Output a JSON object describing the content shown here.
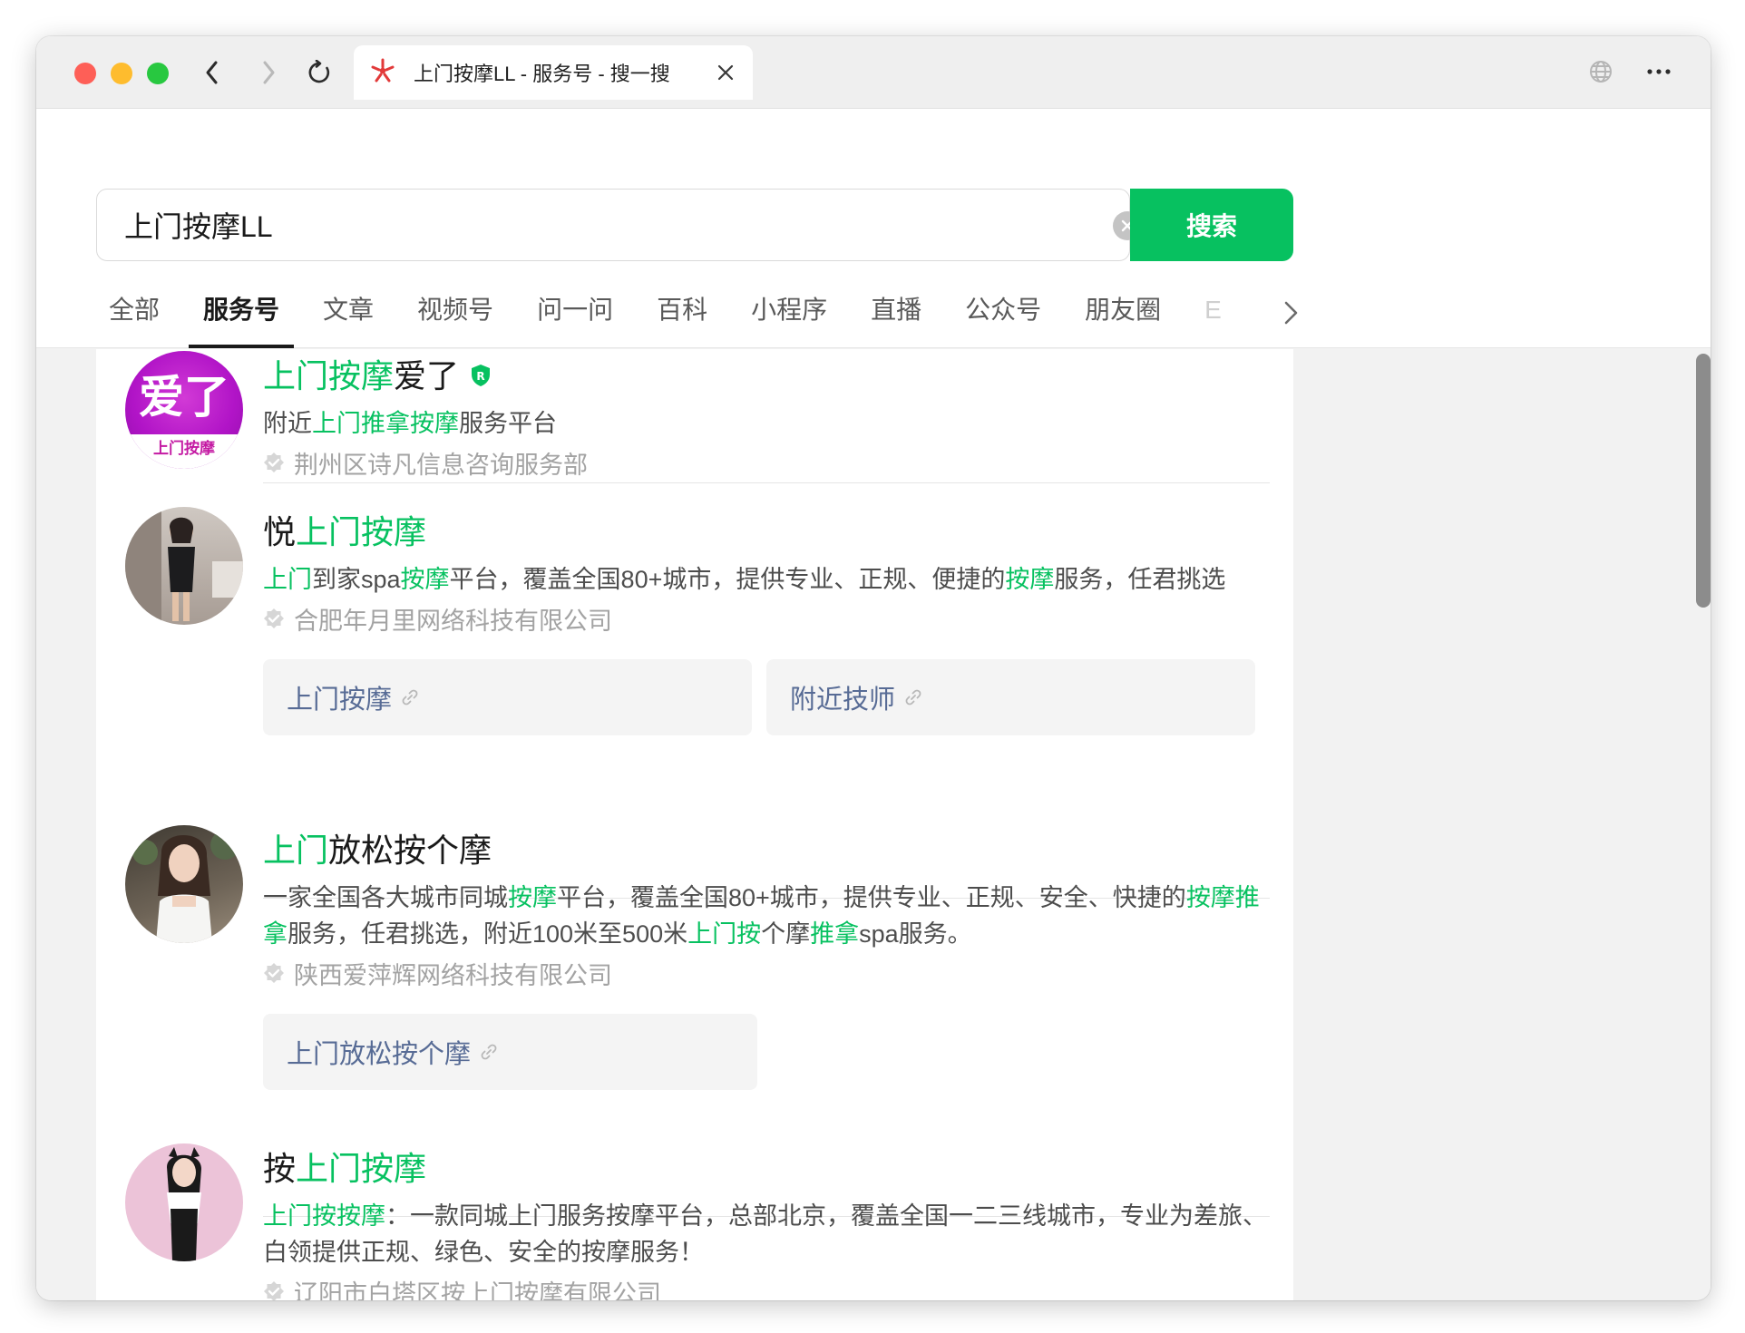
{
  "browser": {
    "tab_title": "上门按摩LL - 服务号 - 搜一搜"
  },
  "search": {
    "query": "上门按摩LL",
    "button_label": "搜索"
  },
  "tabs": [
    "全部",
    "服务号",
    "文章",
    "视频号",
    "问一问",
    "百科",
    "小程序",
    "直播",
    "公众号",
    "朋友圈",
    "E"
  ],
  "active_tab": "服务号",
  "results": [
    {
      "avatar_text": "爱了",
      "avatar_caption": "上门按摩",
      "title_hl": "上门按摩",
      "title_rest": "爱了",
      "badge": "R",
      "desc_pre": "附近",
      "desc_hl": "上门推拿按摩",
      "desc_post": "服务平台",
      "company": "荆州区诗凡信息咨询服务部"
    },
    {
      "title_pre": "悦",
      "title_hl": "上门按摩",
      "desc_parts": [
        "上门",
        "到家spa",
        "按摩",
        "平台，覆盖全国80+城市，提供专业、正规、便捷的",
        "按摩",
        "服务，任君挑选"
      ],
      "company": "合肥年月里网络科技有限公司",
      "links": [
        "上门按摩",
        "附近技师"
      ]
    },
    {
      "title_hl": "上门",
      "title_rest": "放松按个摩",
      "desc_parts": [
        "一家全国各大城市同城",
        "按摩",
        "平台，覆盖全国80+城市，提供专业、正规、安全、快捷的",
        "按摩推拿",
        "服务，任君挑选，附近100米至500米",
        "上门按",
        "个摩",
        "推拿",
        "spa服务。"
      ],
      "company": "陕西爱萍辉网络科技有限公司",
      "links": [
        "上门放松按个摩"
      ]
    },
    {
      "title_pre": "按",
      "title_hl": "上门按摩",
      "desc_hl": "上门按按摩",
      "desc_post": "：一款同城上门服务按摩平台，总部北京，覆盖全国一二三线城市，专业为差旅、白领提供正规、绿色、安全的按摩服务！",
      "company": "辽阳市白塔区按上门按摩有限公司"
    }
  ],
  "colors": {
    "accent": "#07c160",
    "link": "#576b95"
  }
}
